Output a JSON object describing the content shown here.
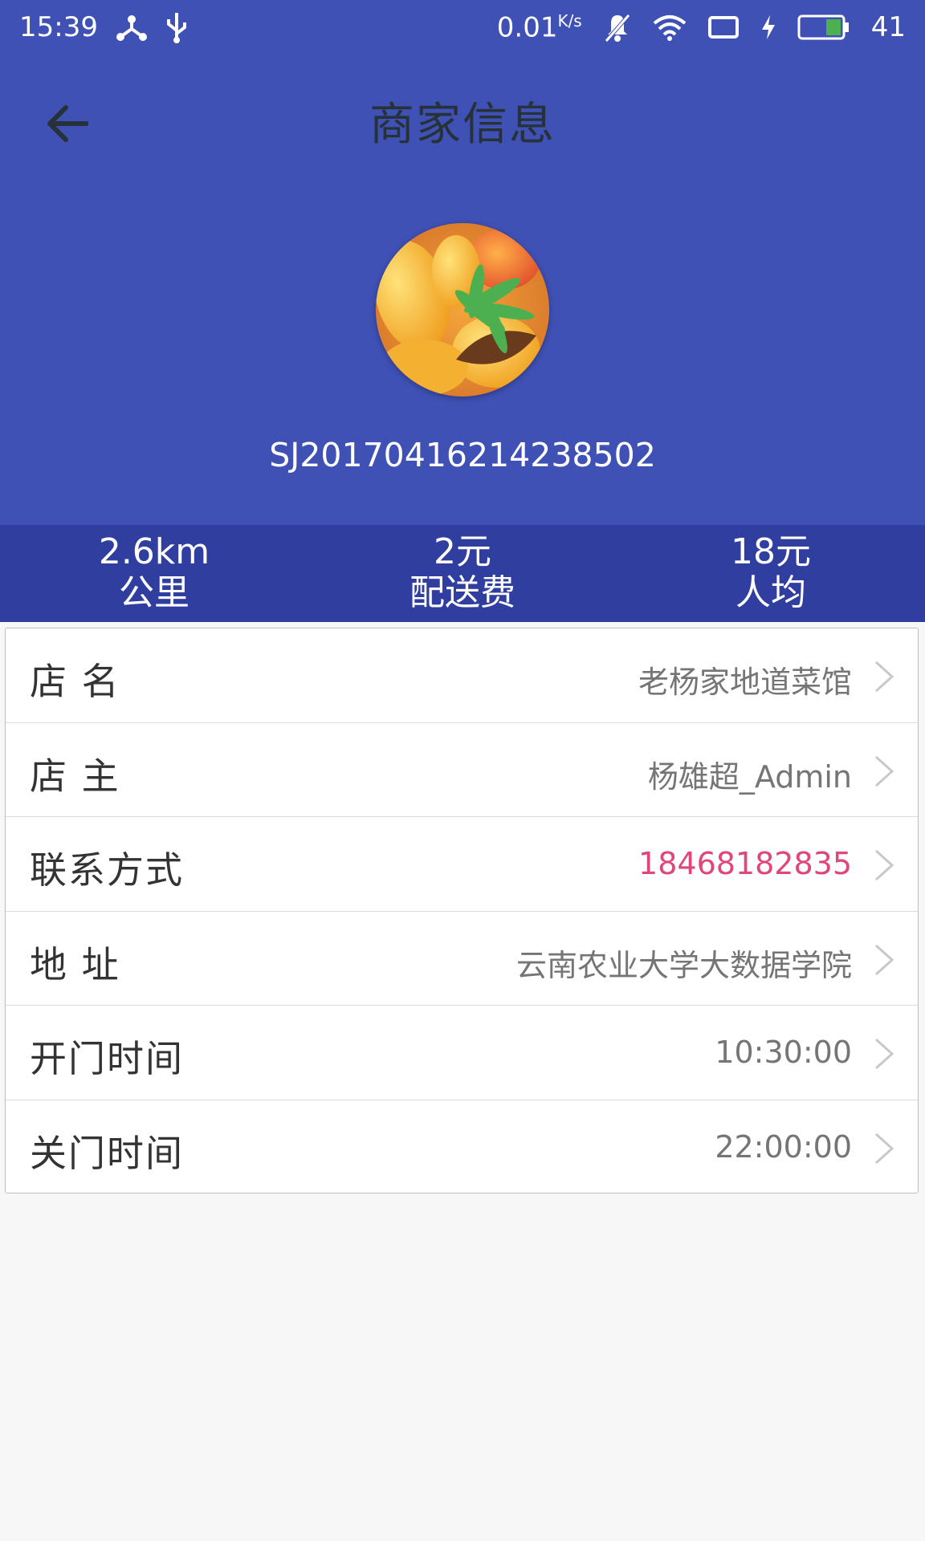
{
  "status_bar": {
    "time": "15:39",
    "net_speed": "0.01",
    "battery": "41"
  },
  "header": {
    "title": "商家信息",
    "merchant_id": "SJ20170416214238502"
  },
  "stats": [
    {
      "value": "2.6km",
      "label": "公里"
    },
    {
      "value": "2元",
      "label": "配送费"
    },
    {
      "value": "18元",
      "label": "人均"
    }
  ],
  "info": {
    "rows": [
      {
        "label": "店 名",
        "value": "老杨家地道菜馆"
      },
      {
        "label": "店 主",
        "value": "杨雄超_Admin"
      },
      {
        "label": "联系方式",
        "value": "18468182835"
      },
      {
        "label": "地 址",
        "value": "云南农业大学大数据学院"
      },
      {
        "label": "开门时间",
        "value": "10:30:00"
      },
      {
        "label": "关门时间",
        "value": "22:00:00"
      }
    ]
  },
  "colors": {
    "primary": "#3f51b5",
    "primary_dark": "#303f9f",
    "phone_accent": "#e0457b"
  },
  "icons": [
    "back-arrow-icon",
    "chevron-right-icon",
    "wifi-icon",
    "battery-icon",
    "usb-icon",
    "mute-icon"
  ]
}
